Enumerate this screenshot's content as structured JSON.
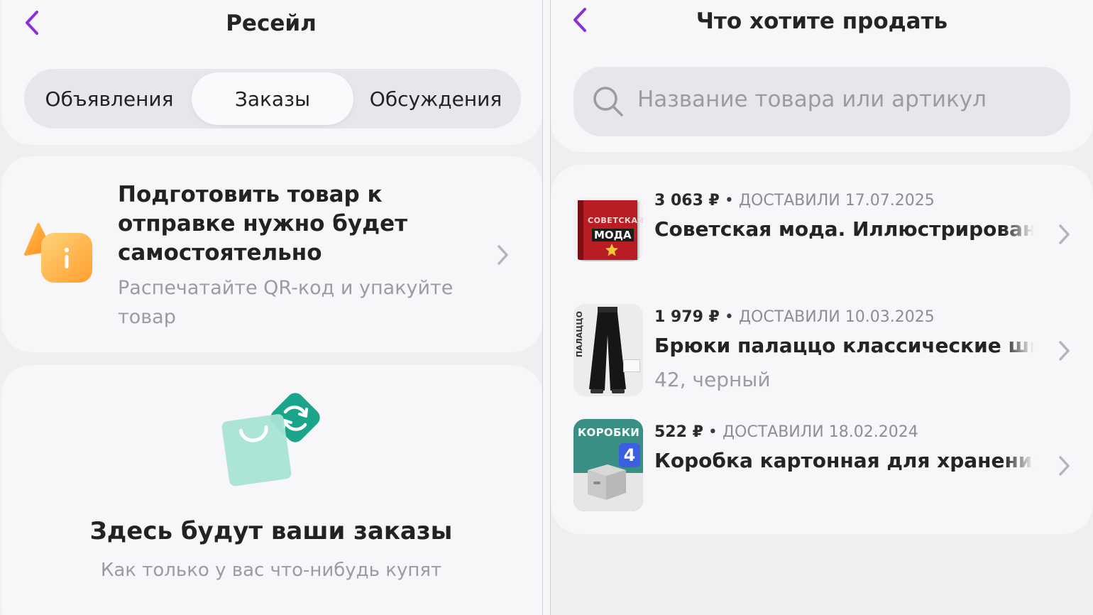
{
  "left": {
    "title": "Ресейл",
    "tabs": [
      {
        "label": "Объявления",
        "active": false
      },
      {
        "label": "Заказы",
        "active": true
      },
      {
        "label": "Обсуждения",
        "active": false
      }
    ],
    "info_card": {
      "title": "Подготовить товар к отправке нужно будет самостоятельно",
      "subtitle": "Распечатайте QR-код и упакуйте товар",
      "icon": "warning-info-icon"
    },
    "empty_state": {
      "title": "Здесь будут ваши заказы",
      "subtitle": "Как только у вас что-нибудь купят",
      "icon": "shopping-bag-exchange-icon"
    }
  },
  "right": {
    "title": "Что хотите продать",
    "search": {
      "placeholder": "Название товара или артикул"
    },
    "items": [
      {
        "price": "3 063 ₽",
        "separator": " • ",
        "status": "ДОСТАВИЛИ 17.07.2025",
        "name": "Советская мода. Иллюстрированный",
        "variant": "",
        "thumb_text_1": "СОВЕТСКАЯ",
        "thumb_text_2": "МОДА"
      },
      {
        "price": "1 979 ₽",
        "separator": " • ",
        "status": "ДОСТАВИЛИ 10.03.2025",
        "name": "Брюки палаццо классические широкие",
        "variant": "42, черный",
        "thumb_text_1": "ПАЛАЦЦО"
      },
      {
        "price": "522 ₽",
        "separator": " • ",
        "status": "ДОСТАВИЛИ 18.02.2024",
        "name": "Коробка картонная для хранения вещей",
        "variant": "",
        "thumb_text_1": "КОРОБКИ",
        "thumb_text_2": "4"
      }
    ]
  },
  "colors": {
    "accent": "#8b2fd9",
    "background": "#efeff2",
    "card": "#f7f7f9",
    "muted": "#9b9ba5"
  }
}
